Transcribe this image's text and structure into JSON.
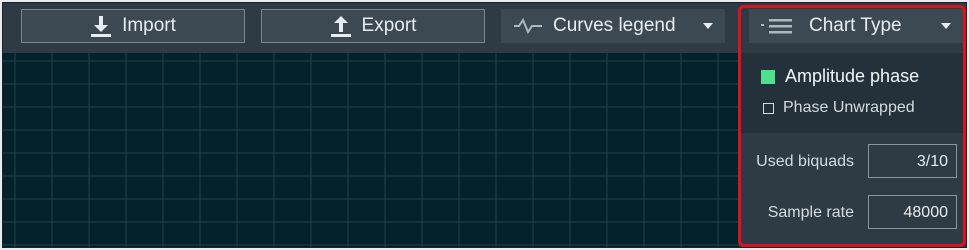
{
  "toolbar": {
    "import_label": "Import",
    "import_icon": "download-icon",
    "export_label": "Export",
    "export_icon": "upload-icon",
    "curves_legend_label": "Curves legend",
    "curves_legend_icon": "waveform-icon"
  },
  "chart_panel": {
    "chart_type_label": "Chart Type",
    "chart_type_icon": "list-icon",
    "options": [
      {
        "label": "Amplitude phase",
        "selected": true,
        "swatch_color": "#4fe08e"
      },
      {
        "label": "Phase Unwrapped",
        "checked": false
      }
    ],
    "used_biquads_label": "Used biquads",
    "used_biquads_value": "3/10",
    "sample_rate_label": "Sample rate",
    "sample_rate_value": "48000"
  },
  "colors": {
    "plot_background": "#04222b",
    "grid": "#21434c",
    "highlight": "#e0111a"
  }
}
